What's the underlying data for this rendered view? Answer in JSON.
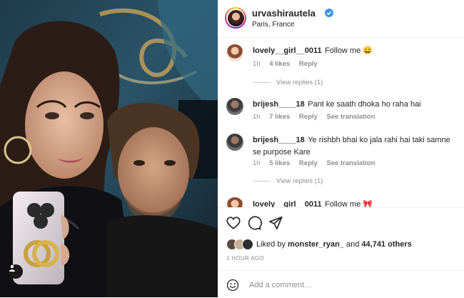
{
  "post": {
    "username": "urvashirautela",
    "location": "Paris, France",
    "verified_color": "#3897f0"
  },
  "comments": [
    {
      "user": "lovely__girl__0011",
      "text": "Follow me 😄",
      "time": "1h",
      "likes": "4 likes",
      "reply": "Reply",
      "translate": "",
      "view_replies": "View replies (1)"
    },
    {
      "user": "brijesh____18",
      "text": "Pant ke saath dhoka ho raha hai",
      "time": "1h",
      "likes": "7 likes",
      "reply": "Reply",
      "translate": "See translation",
      "view_replies": ""
    },
    {
      "user": "brijesh____18",
      "text": "Ye rishbh bhai ko jala rahi hai taki samne se purpose Kare",
      "time": "1h",
      "likes": "5 likes",
      "reply": "Reply",
      "translate": "See translation",
      "view_replies": "View replies (1)"
    },
    {
      "user": "lovely__girl__0011",
      "text": "Follow me 🎀",
      "time": "",
      "likes": "",
      "reply": "",
      "translate": "",
      "view_replies": ""
    }
  ],
  "actions": {
    "like_icon": "heart-icon",
    "comment_icon": "comment-icon",
    "share_icon": "share-icon"
  },
  "likes": {
    "prefix": "Liked by",
    "user": "monster_ryan_",
    "and": "and",
    "others": "44,741 others"
  },
  "timestamp": "1 HOUR AGO",
  "add_comment": {
    "placeholder": "Add a comment…",
    "icon": "emoji-icon"
  }
}
